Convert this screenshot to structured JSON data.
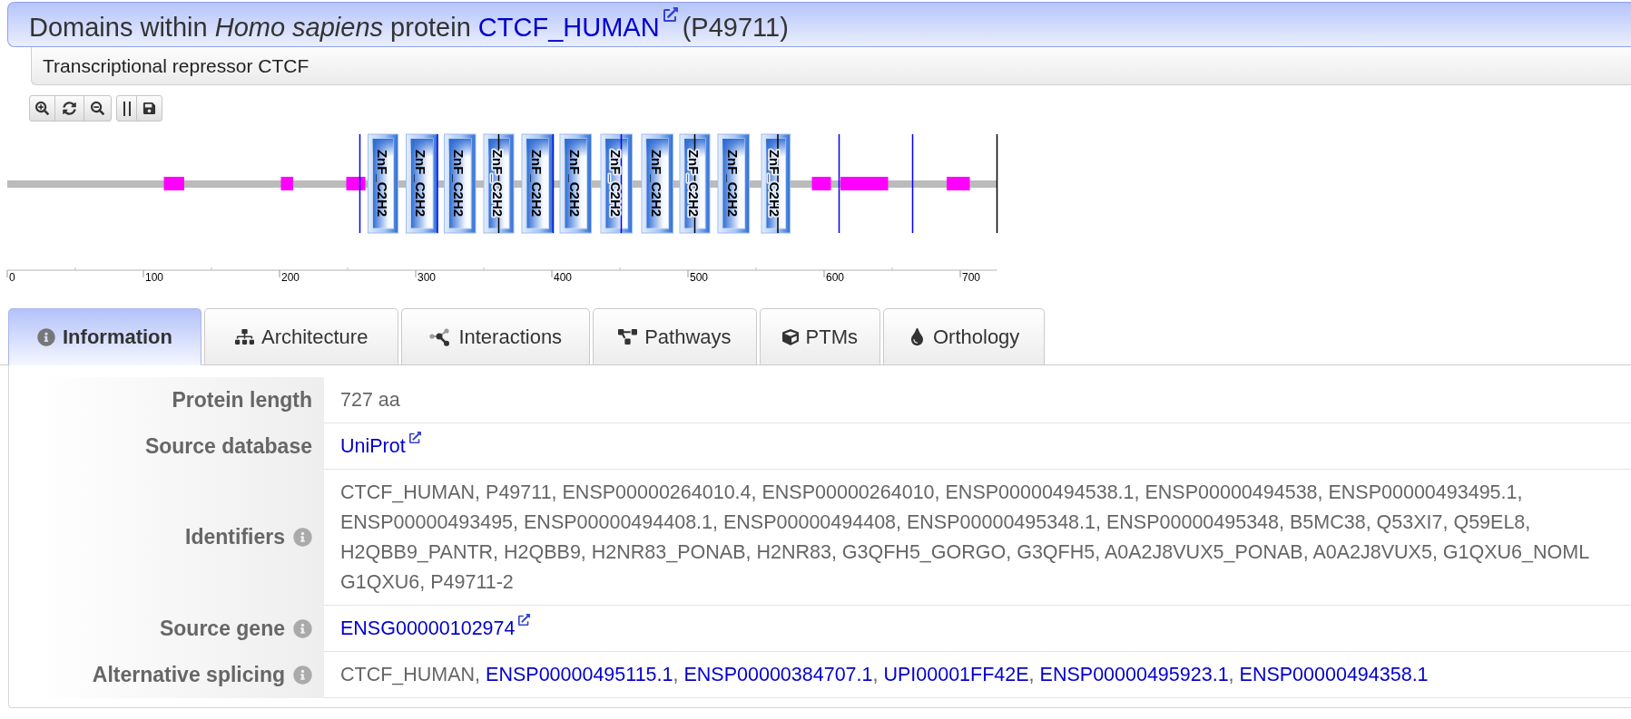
{
  "header": {
    "title": "Domains within *Homo sapiens* protein",
    "protein_link": "CTCF_HUMAN",
    "accession": "(P49711)"
  },
  "subtitle": "Transcriptional repressor CTCF",
  "diagram": {
    "domains": [
      {
        "label": "ZnF_C2H2"
      },
      {
        "label": "ZnF_C2H2"
      },
      {
        "label": "ZnF_C2H2"
      },
      {
        "label": "ZnF_C2H2"
      },
      {
        "label": "ZnF_C2H2"
      },
      {
        "label": "ZnF_C2H2"
      },
      {
        "label": "ZnF_C2H2"
      },
      {
        "label": "ZnF_C2H2"
      },
      {
        "label": "ZnF_C2H2"
      },
      {
        "label": "ZnF_C2H2"
      },
      {
        "label": "ZnF_C2H2"
      }
    ],
    "scale_labels": [
      "0",
      "100",
      "200",
      "300",
      "400",
      "500",
      "600",
      "700"
    ]
  },
  "tabs": [
    {
      "label": "Information",
      "selected": true
    },
    {
      "label": "Architecture",
      "selected": false
    },
    {
      "label": "Interactions",
      "selected": false
    },
    {
      "label": "Pathways",
      "selected": false
    },
    {
      "label": "PTMs",
      "selected": false
    },
    {
      "label": "Orthology",
      "selected": false
    }
  ],
  "info_rows": [
    {
      "kind": "text",
      "label": "Protein length",
      "has_info": false,
      "value": "727 aa"
    },
    {
      "kind": "link",
      "label": "Source database",
      "has_info": false,
      "value": "UniProt"
    },
    {
      "kind": "lines",
      "label": "Identifiers",
      "has_info": true,
      "lines": [
        "CTCF_HUMAN, P49711, ENSP00000264010.4, ENSP00000264010, ENSP00000494538.1, ENSP00000494538, ENSP00000493495.1,",
        "ENSP00000493495, ENSP00000494408.1, ENSP00000494408, ENSP00000495348.1, ENSP00000495348, B5MC38, Q53XI7, Q59EL8,",
        "H2QBB9_PANTR, H2QBB9, H2NR83_PONAB, H2NR83, G3QFH5_GORGO, G3QFH5, A0A2J8VUX5_PONAB, A0A2J8VUX5, G1QXU6_NOML",
        "G1QXU6, P49711-2"
      ]
    },
    {
      "kind": "link",
      "label": "Source gene",
      "has_info": true,
      "value": "ENSG00000102974"
    },
    {
      "kind": "mixed",
      "label": "Alternative splicing",
      "has_info": true,
      "parts": [
        {
          "kind": "text",
          "text": "CTCF_HUMAN,"
        },
        {
          "kind": "link",
          "text": "ENSP00000495115.1"
        },
        {
          "kind": "text",
          "text": ","
        },
        {
          "kind": "link",
          "text": "ENSP00000384707.1"
        },
        {
          "kind": "text",
          "text": ","
        },
        {
          "kind": "link",
          "text": "UPI00001FF42E"
        },
        {
          "kind": "text",
          "text": ","
        },
        {
          "kind": "link",
          "text": "ENSP00000495923.1"
        },
        {
          "kind": "text",
          "text": ","
        },
        {
          "kind": "link",
          "text": "ENSP00000494358.1"
        }
      ]
    }
  ]
}
